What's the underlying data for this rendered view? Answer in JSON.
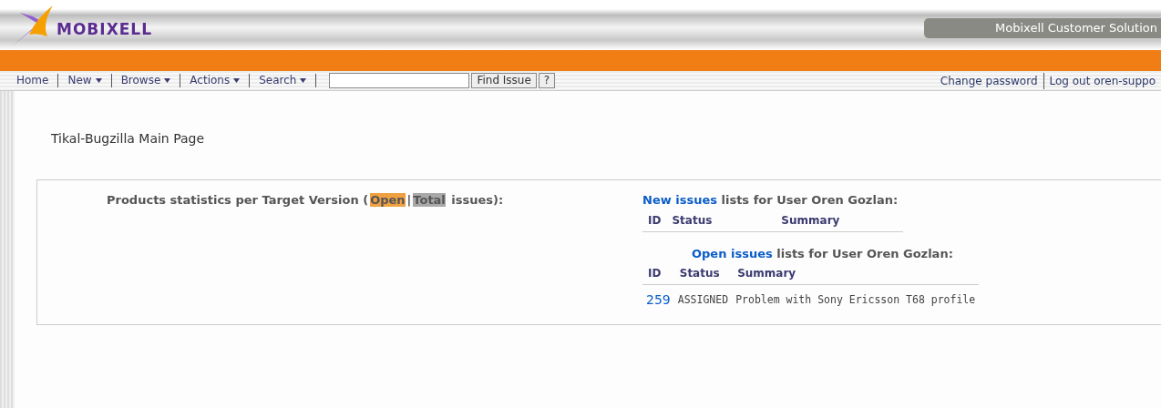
{
  "header": {
    "logo_text": "MOBIXELL",
    "tagline": "Mobixell Customer Solution"
  },
  "nav": {
    "items": [
      {
        "label": "Home",
        "dropdown": false
      },
      {
        "label": "New",
        "dropdown": true
      },
      {
        "label": "Browse",
        "dropdown": true
      },
      {
        "label": "Actions",
        "dropdown": true
      },
      {
        "label": "Search",
        "dropdown": true
      }
    ],
    "find_button": "Find Issue",
    "help_button": "?",
    "right_links": [
      "Change password",
      "Log out oren-suppo"
    ]
  },
  "page_title": "Tikal-Bugzilla Main Page",
  "stats": {
    "prefix": "Products statistics per Target Version (",
    "legend": [
      {
        "label": "Open",
        "color": "#f0a040"
      },
      {
        "label": "Total",
        "color": "#a8a8a8"
      }
    ],
    "separator": "|",
    "suffix": " issues):"
  },
  "lists": [
    {
      "link": "New issues",
      "text": " lists for User Oren Gozlan:",
      "columns": [
        "ID",
        "Status",
        "Summary"
      ]
    },
    {
      "link": "Open issues",
      "text": " lists for User Oren Gozlan:",
      "columns": [
        "ID",
        "Status",
        "Summary"
      ],
      "rows": [
        {
          "id": "259",
          "status": "ASSIGNED",
          "summary": "Problem with Sony Ericsson T68 profile"
        }
      ]
    }
  ]
}
